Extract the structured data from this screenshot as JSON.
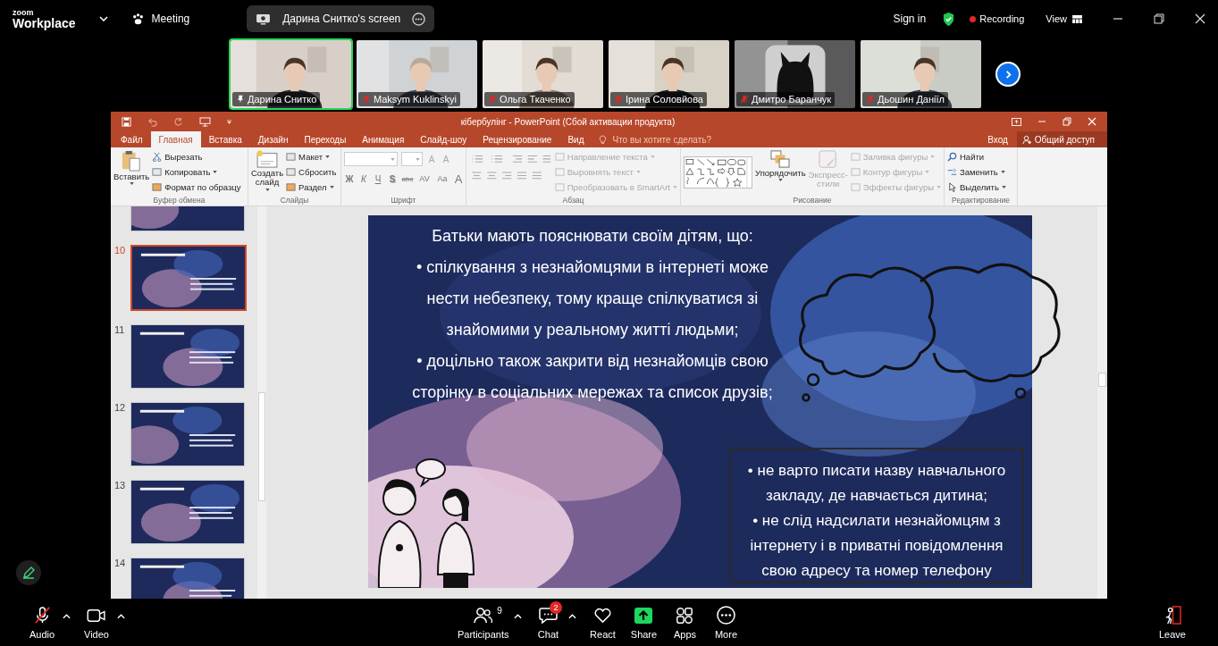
{
  "zoom": {
    "brand_top": "zoom",
    "brand": "Workplace",
    "meeting": "Meeting",
    "shared_screen": "Дарина Снитко's screen",
    "sign_in": "Sign in",
    "recording": "Recording",
    "view": "View"
  },
  "participants": [
    {
      "name": "Дарина Снитко",
      "pinned": true,
      "muted": false,
      "active": true
    },
    {
      "name": "Maksym Kuklinskyi",
      "pinned": false,
      "muted": true,
      "active": false
    },
    {
      "name": "Ольга Ткаченко",
      "pinned": false,
      "muted": true,
      "active": false
    },
    {
      "name": "Ірина Соловйова",
      "pinned": false,
      "muted": true,
      "active": false
    },
    {
      "name": "Дмитро Баранчук",
      "pinned": false,
      "muted": true,
      "active": false
    },
    {
      "name": "Дьошин Даніїл",
      "pinned": false,
      "muted": true,
      "active": false
    }
  ],
  "powerpoint": {
    "title": "кібербулінг - PowerPoint (Сбой активации продукта)",
    "tabs": [
      {
        "label": "Файл",
        "selected": false
      },
      {
        "label": "Главная",
        "selected": true
      },
      {
        "label": "Вставка",
        "selected": false
      },
      {
        "label": "Дизайн",
        "selected": false
      },
      {
        "label": "Переходы",
        "selected": false
      },
      {
        "label": "Анимация",
        "selected": false
      },
      {
        "label": "Слайд-шоу",
        "selected": false
      },
      {
        "label": "Рецензирование",
        "selected": false
      },
      {
        "label": "Вид",
        "selected": false
      }
    ],
    "tell_me": {
      "placeholder": "Что вы хотите сделать?"
    },
    "sign_in": "Вход",
    "share": "Общий доступ",
    "ribbon": [
      {
        "kind": "clipboard",
        "label": "Буфер обмена",
        "main": [
          "Вставить"
        ],
        "items": [
          "Вырезать",
          "Копировать",
          "Формат по образцу"
        ]
      },
      {
        "kind": "slides",
        "label": "Слайды",
        "main": [
          "Создать",
          "слайд"
        ],
        "items": [
          "Макет",
          "Сбросить",
          "Раздел"
        ]
      },
      {
        "kind": "font",
        "label": "Шрифт",
        "size_buttons": [
          "A",
          "A"
        ],
        "buttons": [
          "Ж",
          "К",
          "Ч",
          "S",
          "abc",
          "AV",
          "Aa",
          "A"
        ]
      },
      {
        "kind": "paragraph",
        "label": "Абзац",
        "items": [
          {
            "text": "Направление текста",
            "disabled": true
          },
          {
            "text": "Выровнять текст",
            "disabled": true
          },
          {
            "text": "Преобразовать в SmartArt",
            "disabled": true
          }
        ]
      },
      {
        "kind": "drawing",
        "label": "Рисование",
        "arrange": "Упорядочить",
        "styles": [
          "Экспресс-",
          "стили"
        ],
        "items": [
          {
            "text": "Заливка фигуры",
            "disabled": true
          },
          {
            "text": "Контур фигуры",
            "disabled": true
          },
          {
            "text": "Эффекты фигуры",
            "disabled": true
          }
        ]
      },
      {
        "kind": "editing",
        "label": "Редактирование",
        "items": [
          "Найти",
          "Заменить",
          "Выделить"
        ]
      }
    ],
    "thumbnails": [
      {
        "selected": false
      },
      {
        "number": "10",
        "selected": true
      },
      {
        "number": "11",
        "selected": false
      },
      {
        "number": "12",
        "selected": false
      },
      {
        "number": "13",
        "selected": false
      },
      {
        "number": "14",
        "selected": false
      }
    ],
    "slide": {
      "paragraphs": [
        [
          "Батьки мають пояснювати своїм дітям, що:"
        ],
        [
          "• спілкування з незнайомцями в інтернеті може",
          "нести небезпеку, тому краще спілкуватися зі",
          "знайомими у реальному житті людьми;"
        ],
        [
          "• доцільно також закрити від незнайомців свою",
          "сторінку в соціальних мережах та список друзів;"
        ]
      ],
      "box": [
        [
          "• не варто писати назву навчального",
          "закладу, де навчається дитина;"
        ],
        [
          "• не слід надсилати незнайомцям з",
          "інтернету і в приватні повідомлення",
          "свою адресу та номер телефону"
        ]
      ]
    }
  },
  "toolbar": {
    "items": [
      {
        "kind": "audio",
        "label": "Audio",
        "muted": true,
        "caret": true
      },
      {
        "kind": "video",
        "label": "Video",
        "caret": true
      },
      {
        "kind": "participants",
        "label": "Participants",
        "count": "9",
        "caret": true
      },
      {
        "kind": "chat",
        "label": "Chat",
        "badge": "2",
        "caret": true
      },
      {
        "kind": "react",
        "label": "React",
        "caret": false
      },
      {
        "kind": "share",
        "label": "Share",
        "caret": false
      },
      {
        "kind": "apps",
        "label": "Apps",
        "caret": false
      },
      {
        "kind": "more",
        "label": "More",
        "caret": false
      }
    ],
    "leave": "Leave"
  }
}
